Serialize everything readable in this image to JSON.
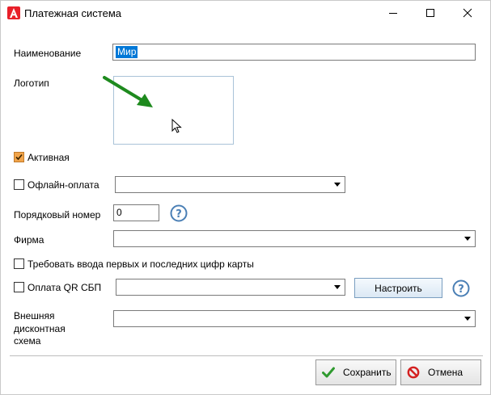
{
  "window": {
    "title": "Платежная система",
    "controls": {
      "minimize_icon": "minimize-icon",
      "maximize_icon": "maximize-icon",
      "close_icon": "close-icon"
    },
    "accent": "#e8202a"
  },
  "form": {
    "name": {
      "label": "Наименование",
      "value": "Мир"
    },
    "logo": {
      "label": "Логотип"
    },
    "active": {
      "label": "Активная",
      "checked": true
    },
    "offline_payment": {
      "label": "Офлайн-оплата",
      "checked": false,
      "value": ""
    },
    "order_number": {
      "label": "Порядковый номер",
      "value": "0"
    },
    "firm": {
      "label": "Фирма",
      "value": ""
    },
    "require_card_digits": {
      "label": "Требовать ввода первых и последних цифр карты",
      "checked": false
    },
    "qr_sbp": {
      "label": "Оплата QR СБП",
      "checked": false,
      "value": "",
      "configure_label": "Настроить"
    },
    "external_discount": {
      "label_line1": "Внешняя",
      "label_line2": "дисконтная",
      "label_line3": "схема",
      "value": ""
    }
  },
  "footer": {
    "save_label": "Сохранить",
    "cancel_label": "Отмена"
  },
  "colors": {
    "selection": "#0078d7",
    "checkbox_checked": "#f1a44a",
    "annotation_arrow": "#1e8a1e",
    "help_icon": "#4a7fb5"
  }
}
